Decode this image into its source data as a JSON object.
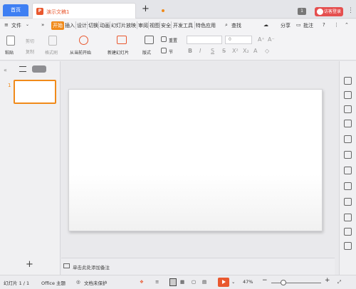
{
  "tabs": {
    "home": "首页",
    "document": "演示文稿1",
    "new_tab": "+",
    "window_count": "1",
    "login": "访客登录"
  },
  "menu": {
    "file": "文件",
    "items": [
      "开始",
      "插入",
      "设计",
      "切换",
      "动画",
      "幻灯片放映",
      "审阅",
      "视图",
      "安全",
      "开发工具",
      "特色应用"
    ],
    "search": "查找",
    "share": "分享",
    "comment": "批注",
    "help": "?"
  },
  "ribbon": {
    "paste": "粘贴",
    "cut": "剪切",
    "copy": "复制",
    "format_painter": "格式刷",
    "from_current": "从当前开始",
    "new_slide": "新建幻灯片",
    "layout": "版式",
    "reset": "重置",
    "section": "节",
    "font_size": "0",
    "bold": "B",
    "italic": "I",
    "underline": "S"
  },
  "left_panel": {
    "slide_number": "1",
    "add": "+"
  },
  "notes": {
    "placeholder": "单击此处添加备注"
  },
  "status": {
    "slide_info": "幻灯片 1 / 1",
    "theme": "Office 主题",
    "protection": "文档未保护",
    "zoom": "47%",
    "zoom_minus": "−",
    "zoom_plus": "+"
  },
  "colors": {
    "accent": "#f08a1a",
    "home_tab": "#3e7ff3",
    "login": "#e54f4f",
    "play": "#e9582f"
  }
}
